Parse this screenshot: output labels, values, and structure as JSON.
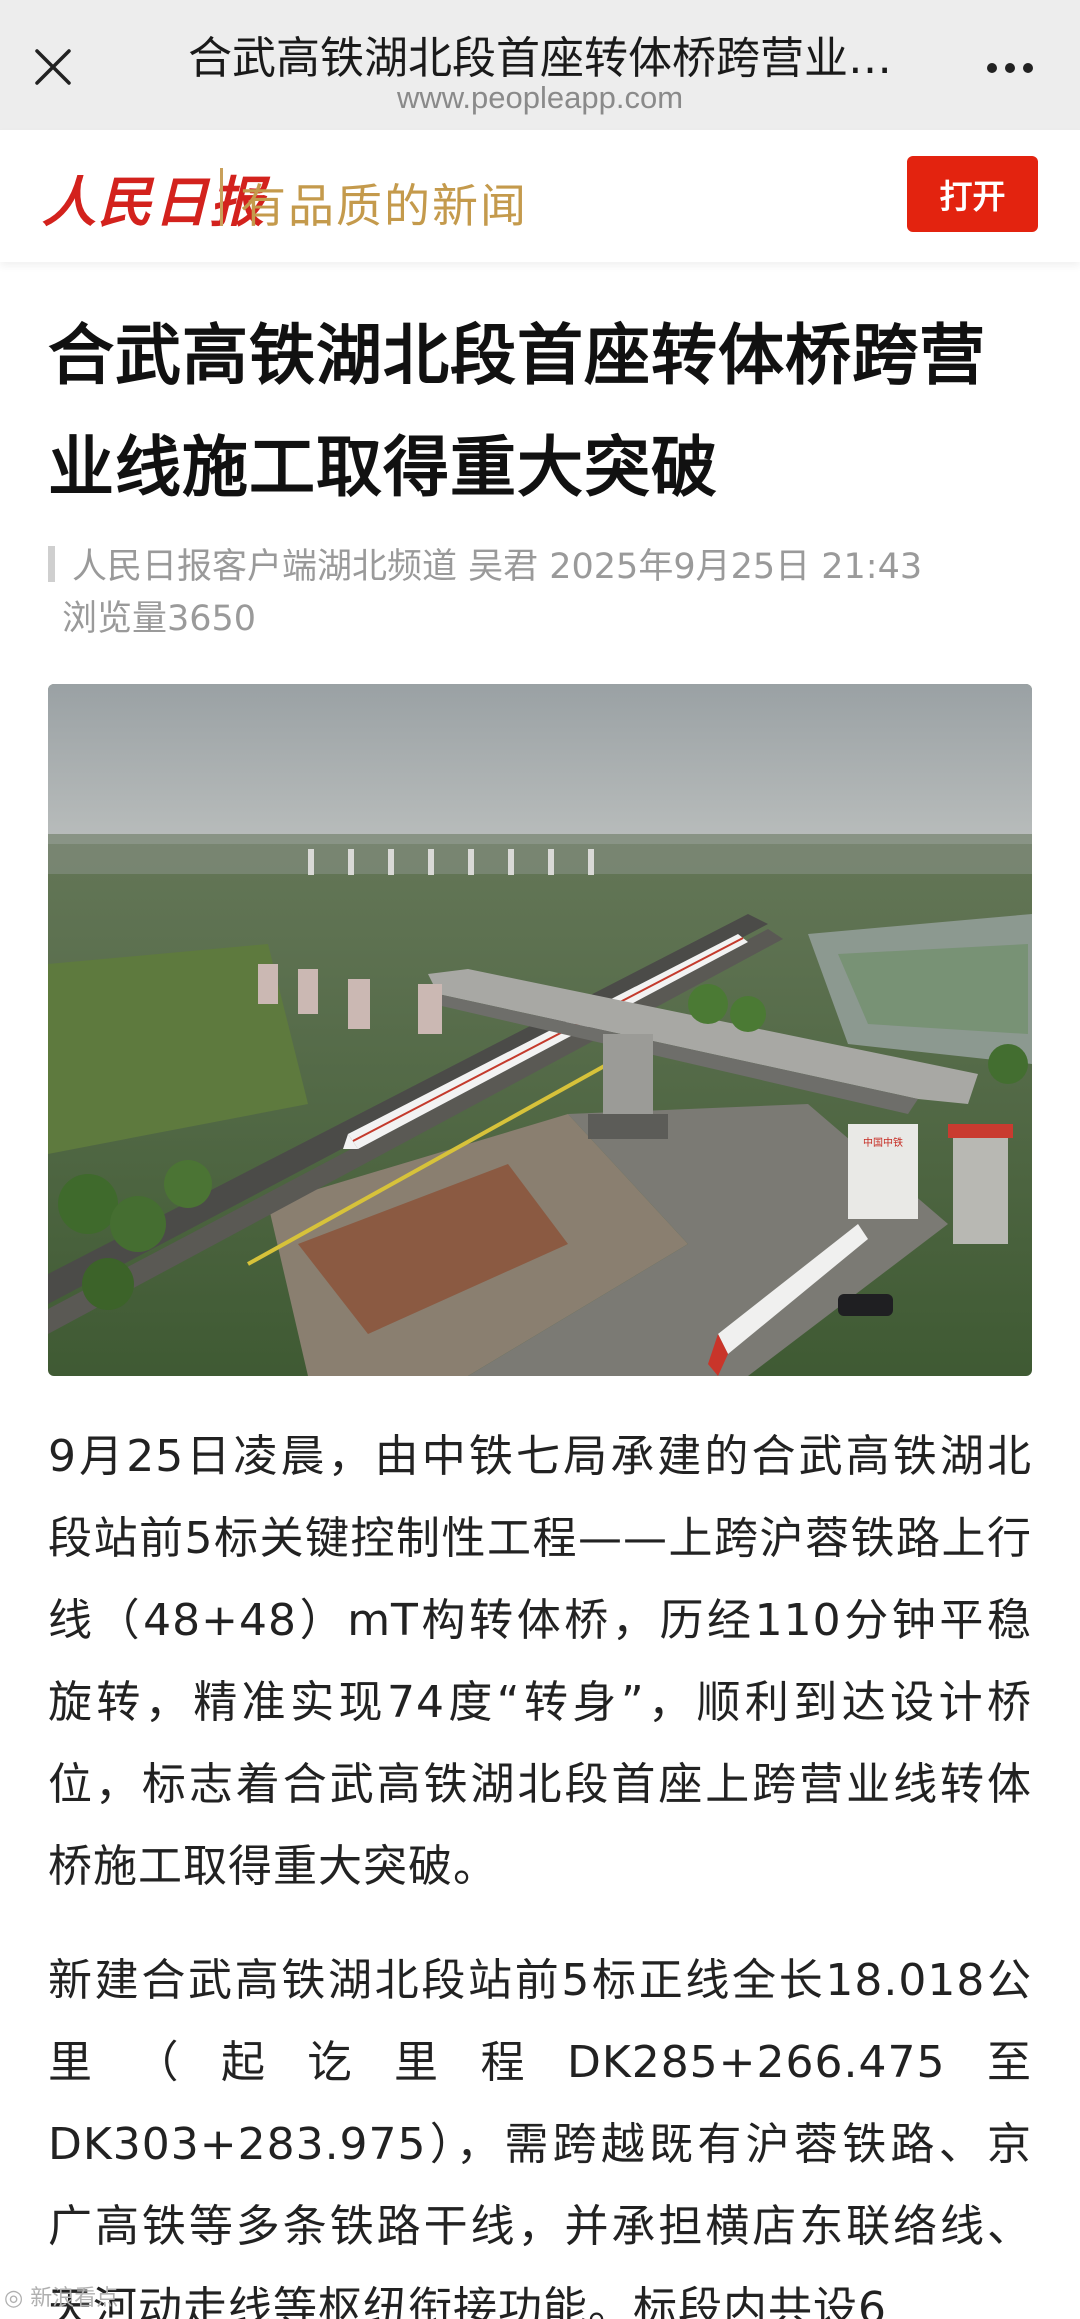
{
  "browser": {
    "title": "合武高铁湖北段首座转体桥跨营业…",
    "url": "www.peopleapp.com"
  },
  "banner": {
    "logo_text": "人民日报",
    "slogan": "有品质的新闻",
    "open_label": "打开",
    "accent_color": "#e3230f"
  },
  "article": {
    "headline": "合武高铁湖北段首座转体桥跨营业线施工取得重大突破",
    "meta_line1": "人民日报客户端湖北频道  吴君  2025年9月25日 21:43",
    "meta_line2": "浏览量3650",
    "paragraph1": "9月25日凌晨，由中铁七局承建的合武高铁湖北段站前5标关键控制性工程——上跨沪蓉铁路上行线（48+48）mT构转体桥，历经110分钟平稳旋转，精准实现74度“转身”，顺利到达设计桥位，标志着合武高铁湖北段首座上跨营业线转体桥施工取得重大突破。",
    "paragraph2": "新建合武高铁湖北段站前5标正线全长18.018公里（起讫里程DK285+266.475至DK303+283.975），需跨越既有沪蓉铁路、京广高铁等多条铁路干线，并承担横店东联络线、天河动走线等枢纽衔接功能。标段内共设6"
  },
  "photo": {
    "sign_text": "中国中铁"
  },
  "watermark": "◎ 新浪看点"
}
